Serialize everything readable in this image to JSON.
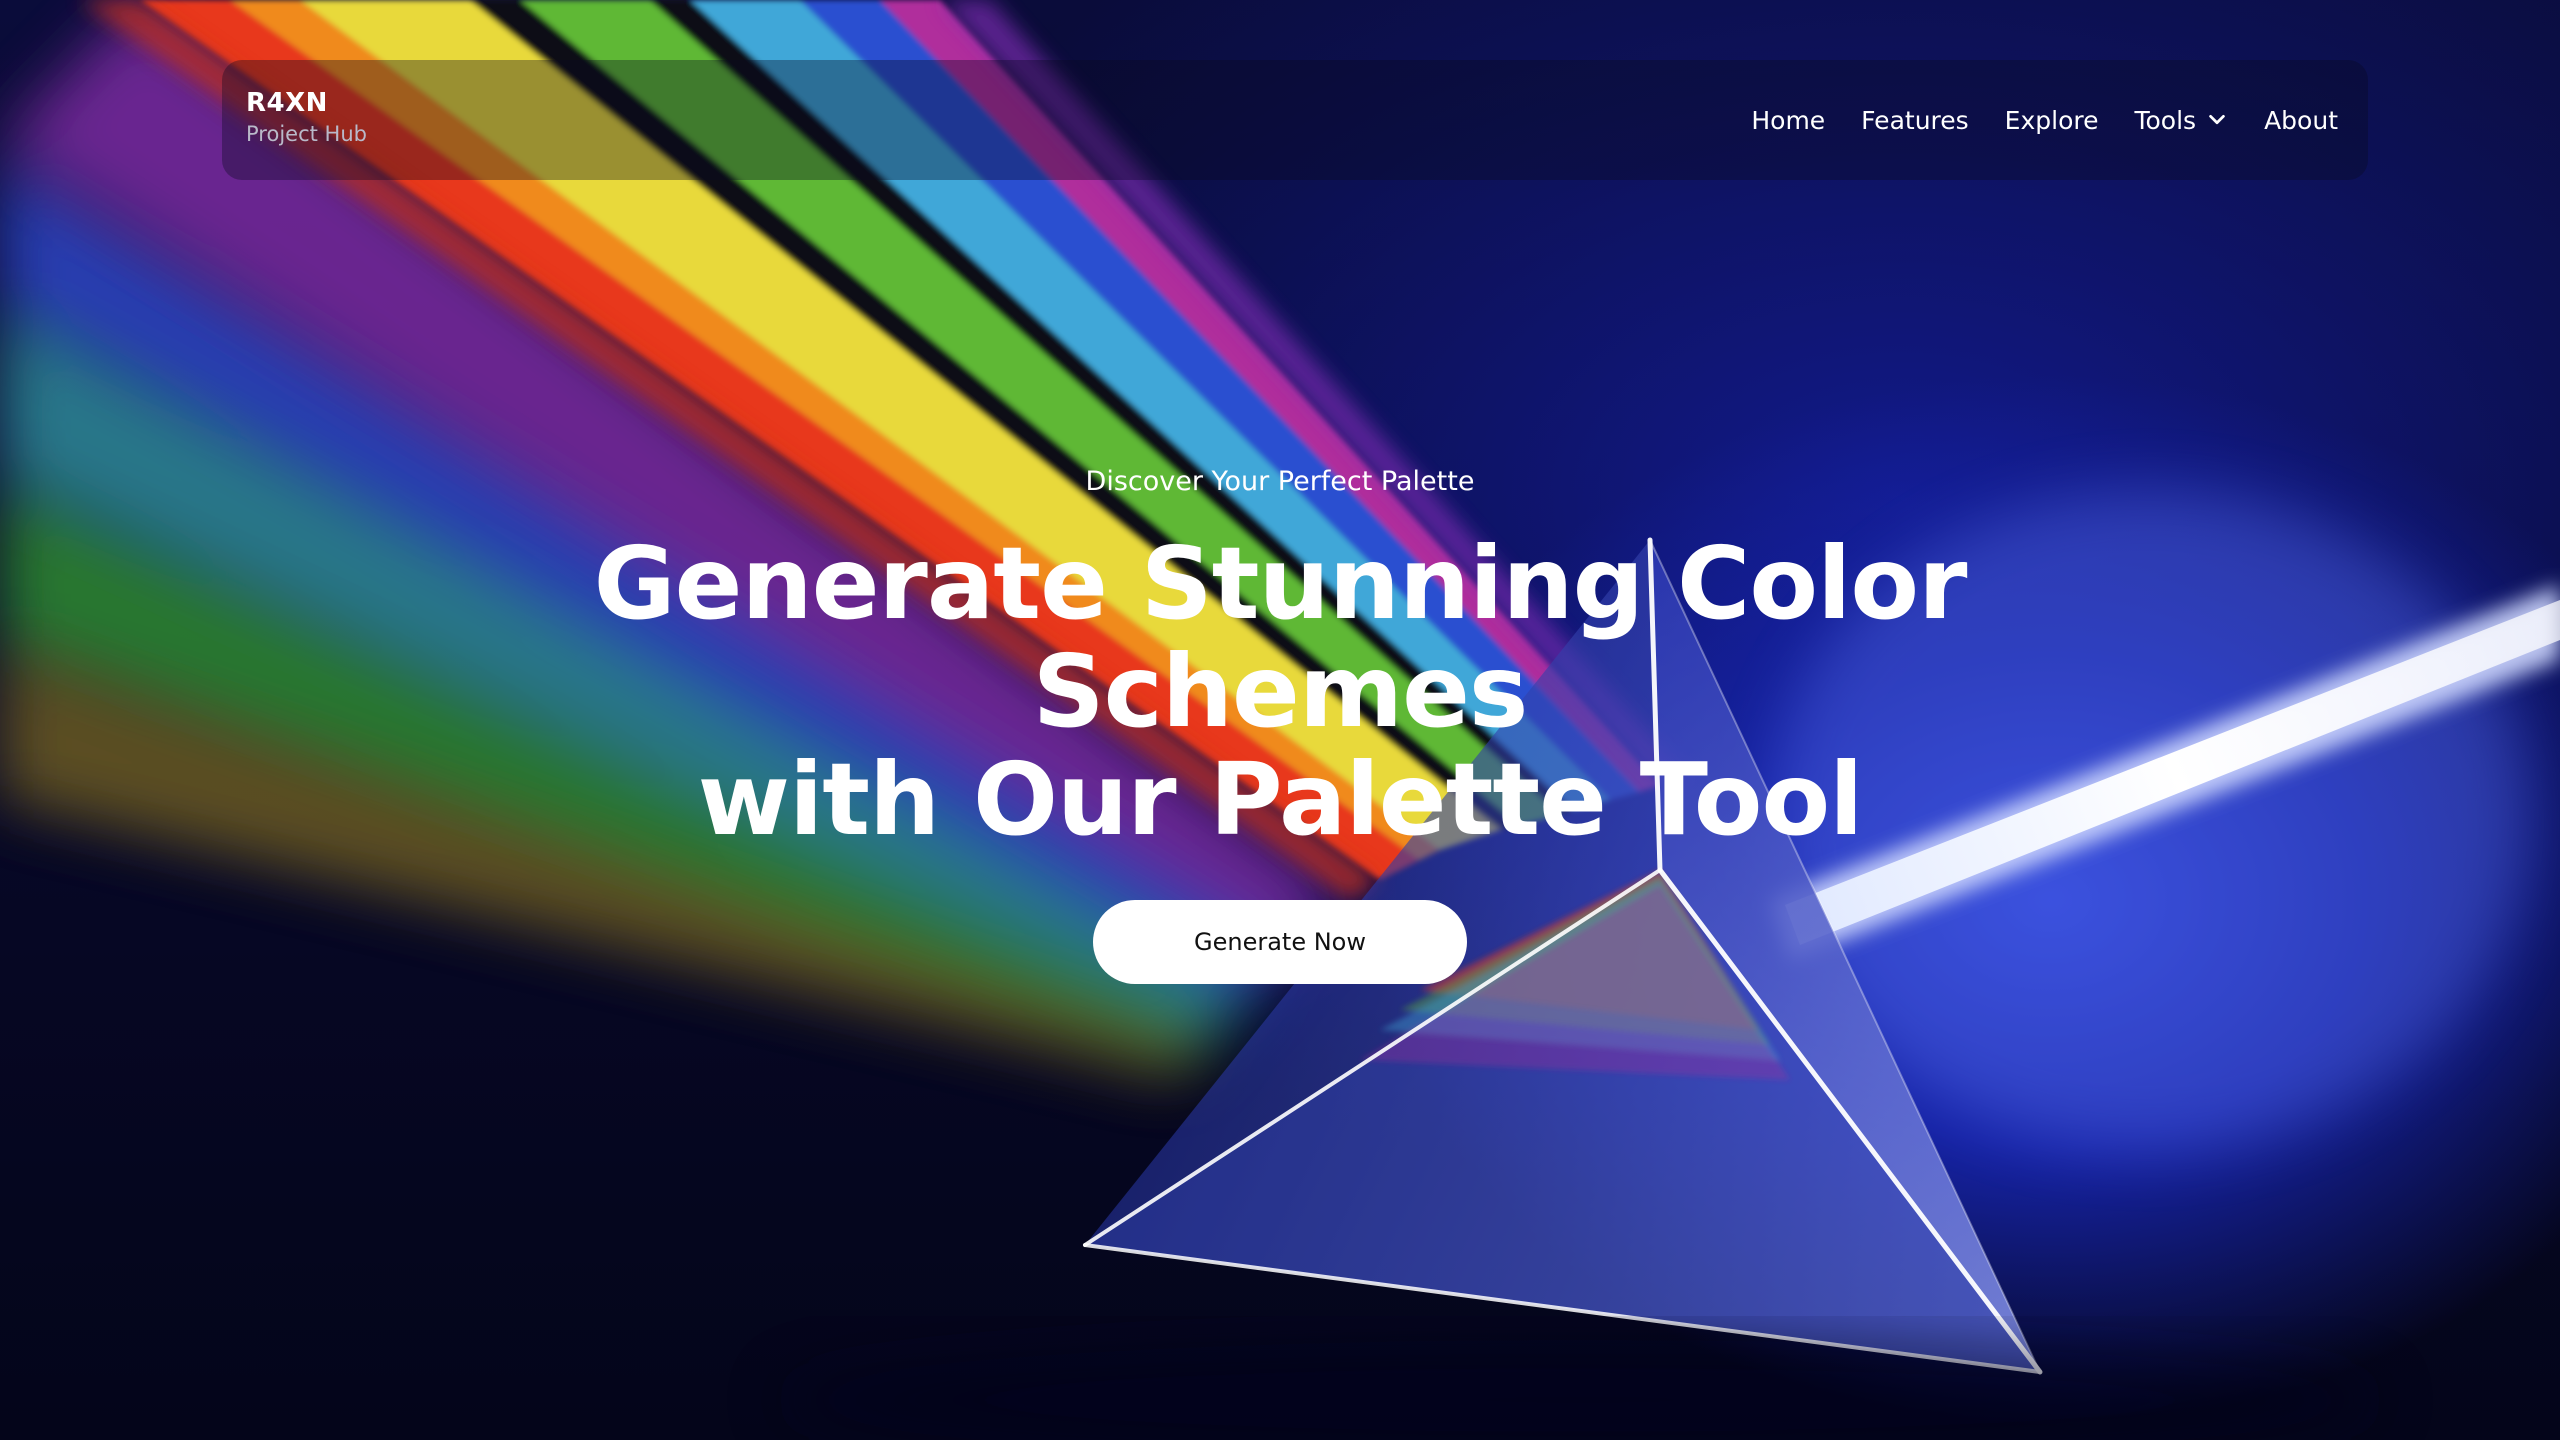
{
  "brand": {
    "title": "R4XN",
    "subtitle": "Project Hub"
  },
  "nav": {
    "items": [
      {
        "label": "Home"
      },
      {
        "label": "Features"
      },
      {
        "label": "Explore"
      },
      {
        "label": "Tools",
        "icon": "chevron-down-icon"
      },
      {
        "label": "About"
      }
    ]
  },
  "hero": {
    "eyebrow": "Discover Your Perfect Palette",
    "headline_line1": "Generate Stunning Color Schemes",
    "headline_line2": "with Our Palette Tool",
    "cta_label": "Generate Now"
  },
  "colors": {
    "background": "#0a0c3a",
    "text": "#ffffff",
    "button_bg": "#ffffff",
    "button_text": "#111111"
  }
}
